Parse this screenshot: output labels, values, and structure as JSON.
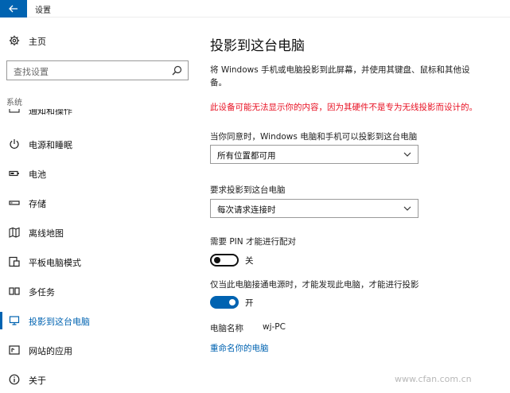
{
  "window": {
    "title": "设置"
  },
  "sidebar": {
    "home_label": "主页",
    "search_placeholder": "查找设置",
    "group_label": "系统",
    "partial_item_label": "通知和操作",
    "items": [
      {
        "label": "电源和睡眠",
        "icon": "power-icon"
      },
      {
        "label": "电池",
        "icon": "battery-icon"
      },
      {
        "label": "存储",
        "icon": "storage-icon"
      },
      {
        "label": "离线地图",
        "icon": "map-icon"
      },
      {
        "label": "平板电脑模式",
        "icon": "tablet-mode-icon"
      },
      {
        "label": "多任务",
        "icon": "multitasking-icon"
      },
      {
        "label": "投影到这台电脑",
        "icon": "project-icon",
        "active": true
      },
      {
        "label": "网站的应用",
        "icon": "apps-for-websites-icon"
      },
      {
        "label": "关于",
        "icon": "info-icon"
      }
    ]
  },
  "main": {
    "title": "投影到这台电脑",
    "description": "将 Windows 手机或电脑投影到此屏幕，并使用其键盘、鼠标和其他设备。",
    "warning": "此设备可能无法显示你的内容，因为其硬件不是专为无线投影而设计的。",
    "setting1": {
      "label": "当你同意时，Windows 电脑和手机可以投影到这台电脑",
      "value": "所有位置都可用"
    },
    "setting2": {
      "label": "要求投影到这台电脑",
      "value": "每次请求连接时"
    },
    "setting3": {
      "label": "需要 PIN 才能进行配对",
      "state": "关",
      "on": false
    },
    "setting4": {
      "label": "仅当此电脑接通电源时，才能发现此电脑，才能进行投影",
      "state": "开",
      "on": true
    },
    "pc_name_label": "电脑名称",
    "pc_name_value": "wj-PC",
    "rename_link": "重命名你的电脑"
  },
  "watermark": "www.cfan.com.cn",
  "colors": {
    "accent": "#0063b1",
    "warning": "#e81123"
  }
}
